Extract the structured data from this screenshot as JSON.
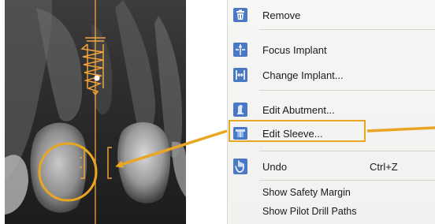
{
  "menu": {
    "items": [
      {
        "label": "Remove",
        "icon": "trash-icon"
      },
      {
        "label": "Focus Implant",
        "icon": "focus-implant-icon"
      },
      {
        "label": "Change Implant...",
        "icon": "change-implant-icon"
      },
      {
        "label": "Edit Abutment...",
        "icon": "abutment-icon"
      },
      {
        "label": "Edit Sleeve...",
        "icon": "sleeve-icon"
      },
      {
        "label": "Undo",
        "icon": "undo-hand-icon",
        "shortcut": "Ctrl+Z"
      }
    ],
    "options": [
      {
        "label": "Show Safety Margin"
      },
      {
        "label": "Show Pilot Drill Paths"
      }
    ]
  },
  "colors": {
    "accent": "#e9a623",
    "icon_blue": "#4a78c2",
    "menu_bg": "#f4f4f2"
  }
}
